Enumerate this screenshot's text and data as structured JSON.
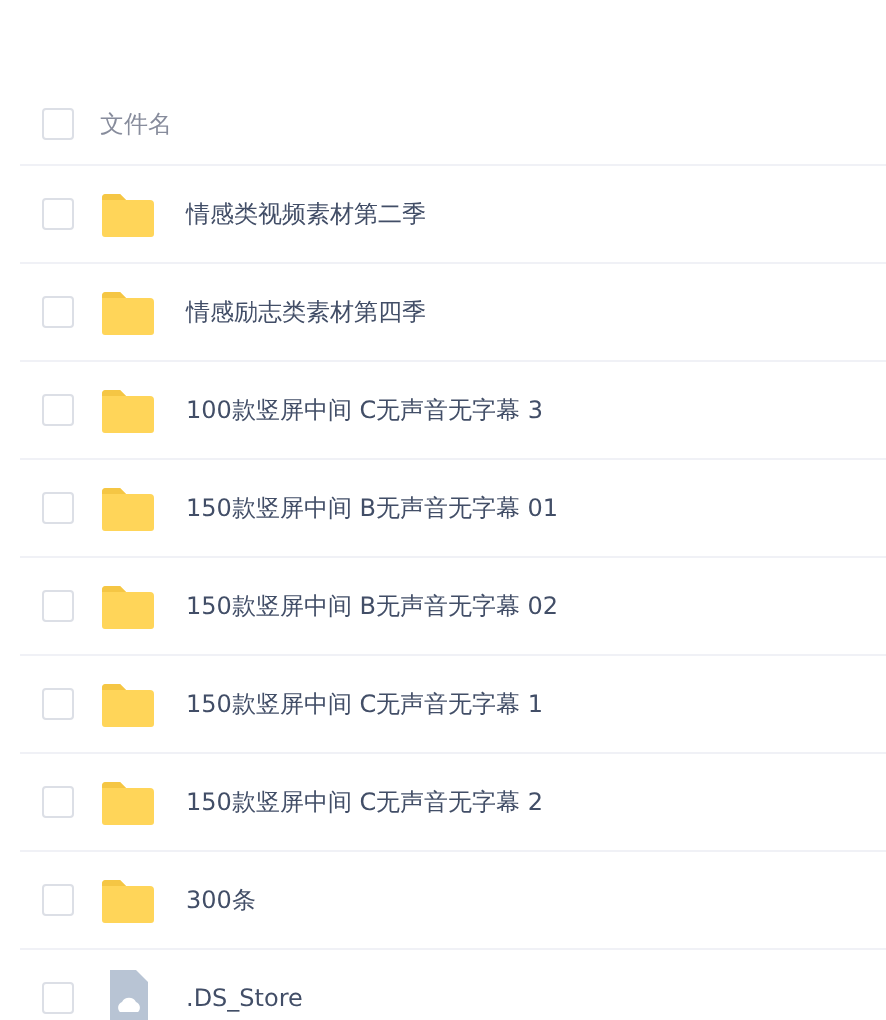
{
  "header": {
    "checked": false,
    "column_1": "文件名"
  },
  "files": [
    {
      "kind": "folder",
      "name": "情感类视频素材第二季",
      "checked": false
    },
    {
      "kind": "folder",
      "name": "情感励志类素材第四季",
      "checked": false
    },
    {
      "kind": "folder",
      "name": "100款竖屏中间 C无声音无字幕 3",
      "checked": false
    },
    {
      "kind": "folder",
      "name": "150款竖屏中间 B无声音无字幕 01",
      "checked": false
    },
    {
      "kind": "folder",
      "name": "150款竖屏中间 B无声音无字幕 02",
      "checked": false
    },
    {
      "kind": "folder",
      "name": "150款竖屏中间 C无声音无字幕 1",
      "checked": false
    },
    {
      "kind": "folder",
      "name": "150款竖屏中间 C无声音无字幕 2",
      "checked": false
    },
    {
      "kind": "folder",
      "name": "300条",
      "checked": false
    },
    {
      "kind": "file",
      "name": ".DS_Store",
      "checked": false
    }
  ]
}
